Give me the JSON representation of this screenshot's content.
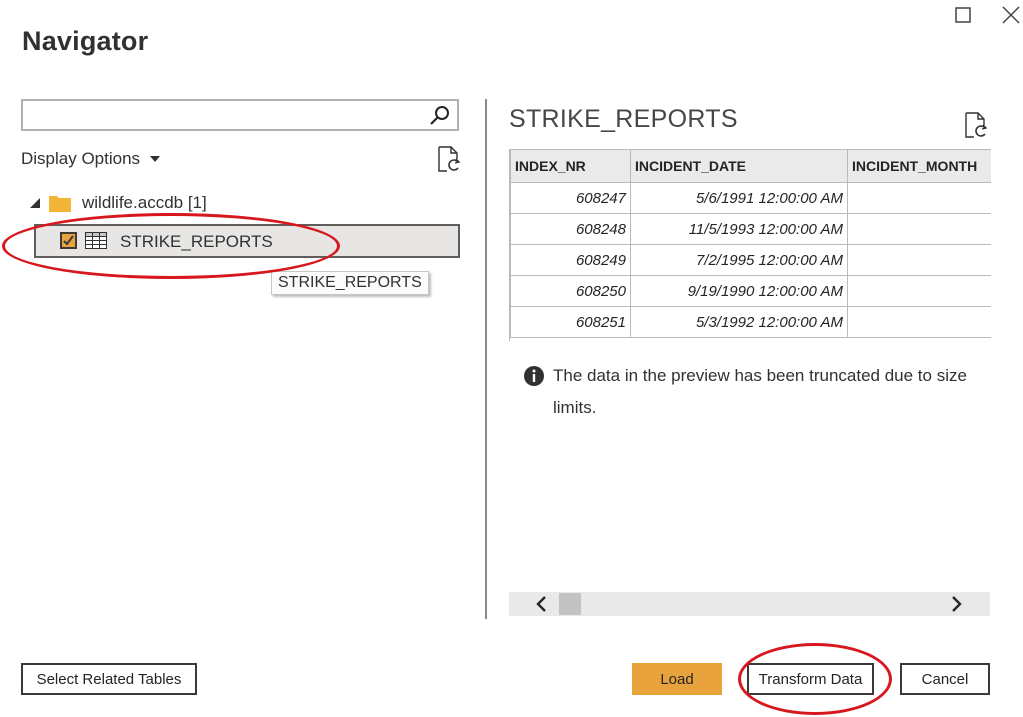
{
  "dialog": {
    "title": "Navigator",
    "maximize_icon": "square-outline-icon",
    "close_icon": "x-icon"
  },
  "left_pane": {
    "search": {
      "value": "",
      "placeholder": ""
    },
    "display_options_label": "Display Options",
    "tree": {
      "source": {
        "label": "wildlife.accdb [1]",
        "icon": "folder-icon",
        "expanded": true
      },
      "items": [
        {
          "label": "STRIKE_REPORTS",
          "checked": true,
          "selected": true,
          "icon": "table-icon"
        }
      ]
    },
    "tooltip": "STRIKE_REPORTS",
    "select_related_label": "Select Related Tables"
  },
  "preview": {
    "title": "STRIKE_REPORTS",
    "columns": [
      "INDEX_NR",
      "INCIDENT_DATE",
      "INCIDENT_MONTH"
    ],
    "rows": [
      [
        "608247",
        "5/6/1991 12:00:00 AM",
        ""
      ],
      [
        "608248",
        "11/5/1993 12:00:00 AM",
        ""
      ],
      [
        "608249",
        "7/2/1995 12:00:00 AM",
        ""
      ],
      [
        "608250",
        "9/19/1990 12:00:00 AM",
        ""
      ],
      [
        "608251",
        "5/3/1992 12:00:00 AM",
        ""
      ]
    ],
    "info_message": "The data in the preview has been truncated due to size limits."
  },
  "footer": {
    "load_label": "Load",
    "transform_label": "Transform Data",
    "cancel_label": "Cancel"
  },
  "colors": {
    "accent": "#e8a33d",
    "annotation": "#d7161d",
    "folder": "#f2b538"
  }
}
